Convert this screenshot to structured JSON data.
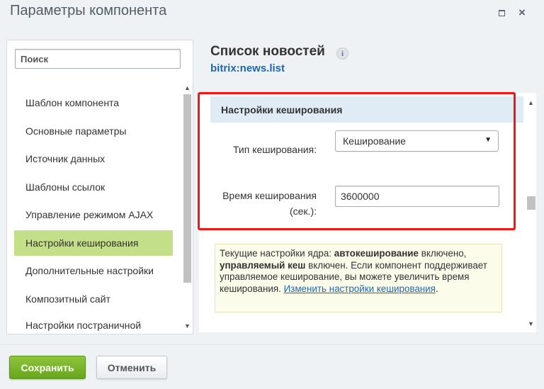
{
  "window": {
    "title": "Параметры компонента",
    "maximize_icon": "maximize-icon",
    "close_icon": "close-icon",
    "close_glyph": "×"
  },
  "sidebar": {
    "search": {
      "placeholder": "Поиск",
      "value": ""
    },
    "items": [
      {
        "label": "Шаблон компонента",
        "active": false
      },
      {
        "label": "Основные параметры",
        "active": false
      },
      {
        "label": "Источник данных",
        "active": false
      },
      {
        "label": "Шаблоны ссылок",
        "active": false
      },
      {
        "label": "Управление режимом AJAX",
        "active": false
      },
      {
        "label": "Настройки кеширования",
        "active": true
      },
      {
        "label": "Дополнительные настройки",
        "active": false
      },
      {
        "label": "Композитный сайт",
        "active": false
      },
      {
        "label": "Настройки постраничной",
        "active": false
      }
    ]
  },
  "main": {
    "title": "Список новостей",
    "info_icon_glyph": "i",
    "subtitle": "bitrix:news.list",
    "section": {
      "title": "Настройки кеширования",
      "cache_type": {
        "label": "Тип кеширования:",
        "value": "Кеширование"
      },
      "cache_time": {
        "label_line1": "Время кеширования",
        "label_line2": "(сек.):",
        "value": "3600000"
      }
    },
    "note": {
      "t1": "Текущие настройки ядра: ",
      "b1": "автокеширование",
      "t2": " включено, ",
      "b2": "управляемый кеш",
      "t3": " включен. Если компонент поддерживает управляемое кеширование, вы можете увеличить время кеширования. ",
      "link": "Изменить настройки кеширования",
      "t4": "."
    }
  },
  "footer": {
    "save_label": "Сохранить",
    "cancel_label": "Отменить"
  },
  "colors": {
    "accent_green": "#8fc53a",
    "active_item": "#c3df87",
    "highlight_frame": "#f31414",
    "link": "#2067b0"
  }
}
